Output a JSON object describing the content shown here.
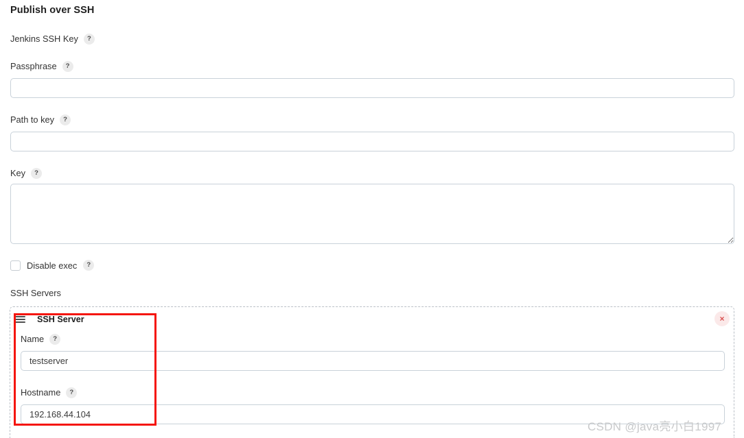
{
  "page": {
    "title": "Publish over SSH"
  },
  "fields": {
    "jenkins_ssh_key": {
      "label": "Jenkins SSH Key",
      "help": "?"
    },
    "passphrase": {
      "label": "Passphrase",
      "help": "?",
      "value": "",
      "placeholder": ""
    },
    "path_to_key": {
      "label": "Path to key",
      "help": "?",
      "value": "",
      "placeholder": ""
    },
    "key": {
      "label": "Key",
      "help": "?",
      "value": "",
      "placeholder": ""
    },
    "disable_exec": {
      "label": "Disable exec",
      "help": "?",
      "checked": false
    }
  },
  "ssh_servers": {
    "label": "SSH Servers",
    "panel": {
      "title": "SSH Server",
      "drag_handle_icon": "hamburger-icon",
      "close_icon": "close-icon",
      "close_label": "×",
      "fields": {
        "name": {
          "label": "Name",
          "help": "?",
          "value": "testserver",
          "placeholder": ""
        },
        "hostname": {
          "label": "Hostname",
          "help": "?",
          "value": "192.168.44.104",
          "placeholder": ""
        }
      }
    }
  },
  "watermark": {
    "text": "CSDN @java亮小白1997"
  },
  "colors": {
    "annotation": "#f5150b",
    "input_border": "#c8d1d9",
    "help_bg": "#ebebeb",
    "close_bg": "#fbe9e9",
    "close_fg": "#d94f4f",
    "dashed_border": "#b9bfc6",
    "watermark": "#c9cacb"
  }
}
